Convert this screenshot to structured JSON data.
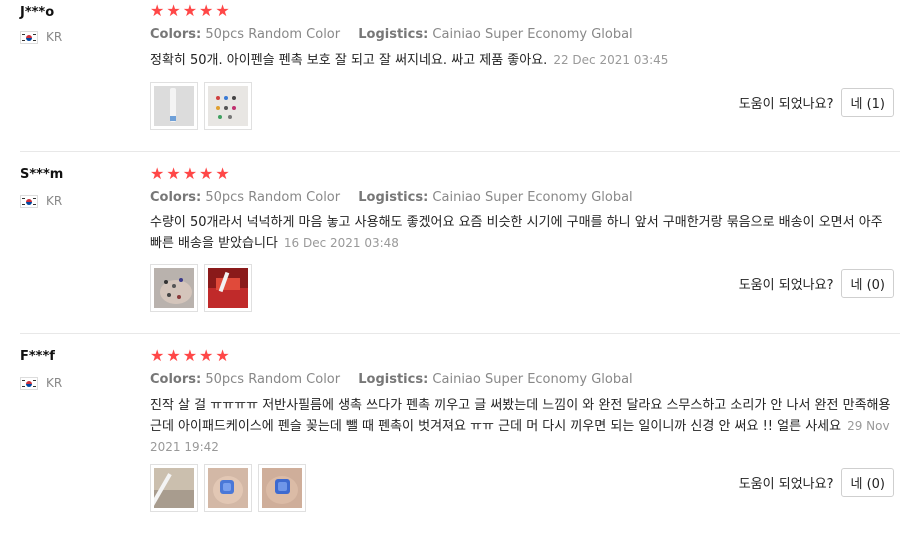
{
  "helpful_label": "도움이 되었나요?",
  "rating_icon": "star-icon",
  "accent_color": "#ff4747",
  "reviews": [
    {
      "user": "J***o",
      "country": "KR",
      "stars": 5,
      "colors_key": "Colors:",
      "colors_value": "50pcs Random Color",
      "logistics_key": "Logistics:",
      "logistics_value": "Cainiao Super Economy Global",
      "text": "정확히 50개. 아이펜슬 펜촉 보호 잘 되고 잘 써지네요. 싸고 제품 좋아요.",
      "date": "22 Dec 2021 03:45",
      "helpful_button": "네 (1)",
      "thumbnails": [
        "photo-pencil",
        "photo-tips"
      ]
    },
    {
      "user": "S***m",
      "country": "KR",
      "stars": 5,
      "colors_key": "Colors:",
      "colors_value": "50pcs Random Color",
      "logistics_key": "Logistics:",
      "logistics_value": "Cainiao Super Economy Global",
      "text": "수량이 50개라서 넉넉하게 마음 놓고 사용해도 좋겠어요 요즘 비슷한 시기에 구매를 하니 앞서 구매한거랑 묶음으로 배송이 오면서 아주 빠른 배송을 받았습니다",
      "date": "16 Dec 2021 03:48",
      "helpful_button": "네 (0)",
      "thumbnails": [
        "photo-tips-hand",
        "photo-red"
      ]
    },
    {
      "user": "F***f",
      "country": "KR",
      "stars": 5,
      "colors_key": "Colors:",
      "colors_value": "50pcs Random Color",
      "logistics_key": "Logistics:",
      "logistics_value": "Cainiao Super Economy Global",
      "text": "진작 살 걸 ㅠㅠㅠㅠ 저반사필름에 생촉 쓰다가 펜촉 끼우고 글 써봤는데 느낌이 와 완전 달라요 스무스하고 소리가 안 나서 완전 만족해용 근데 아이패드케이스에 펜슬 꽂는데 뺄 때 펜촉이 벗겨져요 ㅠㅠ 근데 머 다시 끼우면 되는 일이니까 신경 안 써요 !! 얼른 사세요",
      "date": "29 Nov 2021 19:42",
      "helpful_button": "네 (0)",
      "thumbnails": [
        "photo-pencil-2",
        "photo-blue-tip",
        "photo-blue-tip-2"
      ]
    }
  ]
}
